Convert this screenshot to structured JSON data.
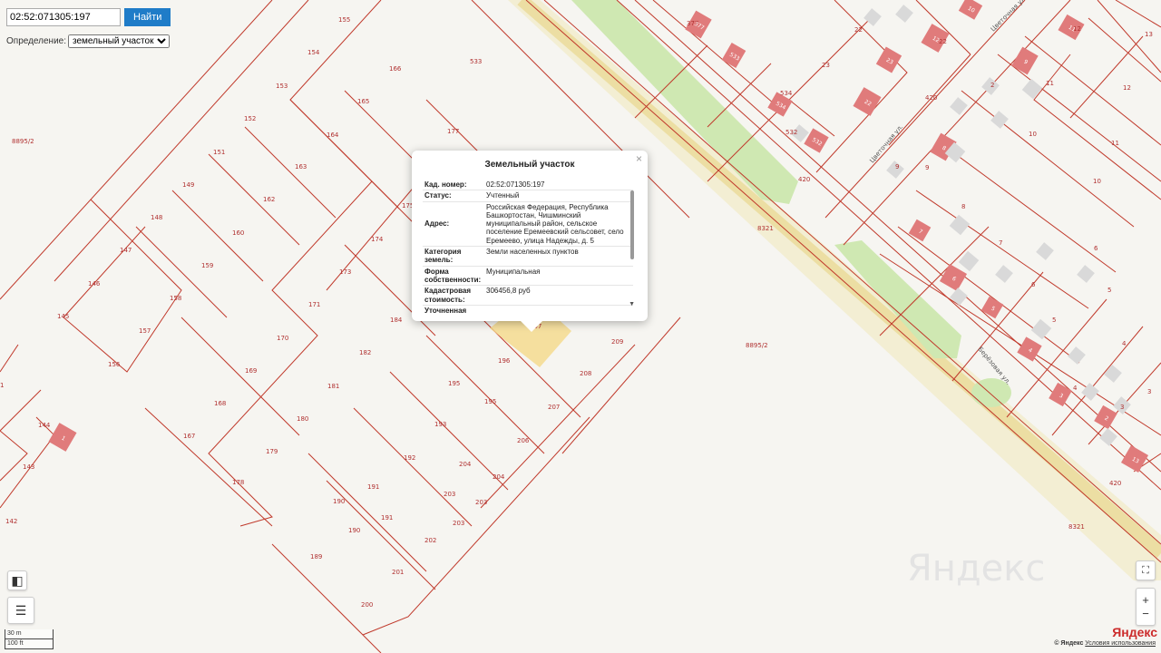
{
  "search": {
    "value": "02:52:071305:197",
    "button": "Найти"
  },
  "definition": {
    "label": "Определение:",
    "selected": "земельный участок"
  },
  "popup": {
    "title": "Земельный участок",
    "close": "×",
    "rows": [
      {
        "k": "Кад. номер:",
        "v": "02:52:071305:197"
      },
      {
        "k": "Статус:",
        "v": "Учтенный"
      },
      {
        "k": "Адрес:",
        "v": "Российская Федерация, Республика Башкортостан, Чишминский муниципальный район, сельское поселение Еремеевский сельсовет, село Еремеево, улица Надежды, д. 5"
      },
      {
        "k": "Категория земель:",
        "v": "Земли населенных пунктов"
      },
      {
        "k": "Форма собственности:",
        "v": "Муниципальная"
      },
      {
        "k": "Кадастровая стоимость:",
        "v": "306456,8 руб"
      },
      {
        "k": "Уточненная",
        "v": ""
      }
    ]
  },
  "parcels": [
    "155",
    "154",
    "166",
    "153",
    "165",
    "152",
    "164",
    "151",
    "163",
    "149",
    "162",
    "148",
    "160",
    "175",
    "174",
    "173",
    "171",
    "170",
    "169",
    "168",
    "167",
    "147",
    "159",
    "146",
    "158",
    "145",
    "157",
    "156",
    "144",
    "143",
    "142",
    "177",
    "184",
    "182",
    "181",
    "180",
    "179",
    "178",
    "190",
    "191",
    "189",
    "190",
    "191",
    "192",
    "193",
    "195",
    "195",
    "196",
    "197",
    "203",
    "203",
    "203",
    "204",
    "204",
    "202",
    "201",
    "200",
    "206",
    "207",
    "208",
    "209",
    "8895/2",
    "8895/2",
    "8321",
    "8321",
    "420",
    "420",
    "420",
    "533",
    "377",
    "22",
    "23",
    "534",
    "532",
    "22",
    "12",
    "13",
    "12",
    "11",
    "10",
    "9",
    "8",
    "7",
    "6",
    "6",
    "5",
    "5",
    "4",
    "4",
    "3",
    "3",
    "11",
    "2",
    "10",
    "9",
    "1"
  ],
  "streets": [
    "Цветочная ул.",
    "Цветочная ул.",
    "Берёзовая ул."
  ],
  "house_numbers": [
    "377",
    "533",
    "534",
    "532",
    "22",
    "23",
    "12",
    "11",
    "9",
    "8",
    "7",
    "6",
    "5",
    "4",
    "3",
    "2",
    "13",
    "1",
    "10"
  ],
  "copyright": {
    "text": "© Яндекс",
    "link": "Условия использования"
  },
  "logo": "Яндекс",
  "watermark": "Яндекс",
  "scale": {
    "m": "30 m",
    "ft": "100 ft"
  },
  "zoom": {
    "in": "+",
    "out": "−"
  },
  "icons": [
    "ruler-icon",
    "layers-icon",
    "fullscreen-icon"
  ]
}
